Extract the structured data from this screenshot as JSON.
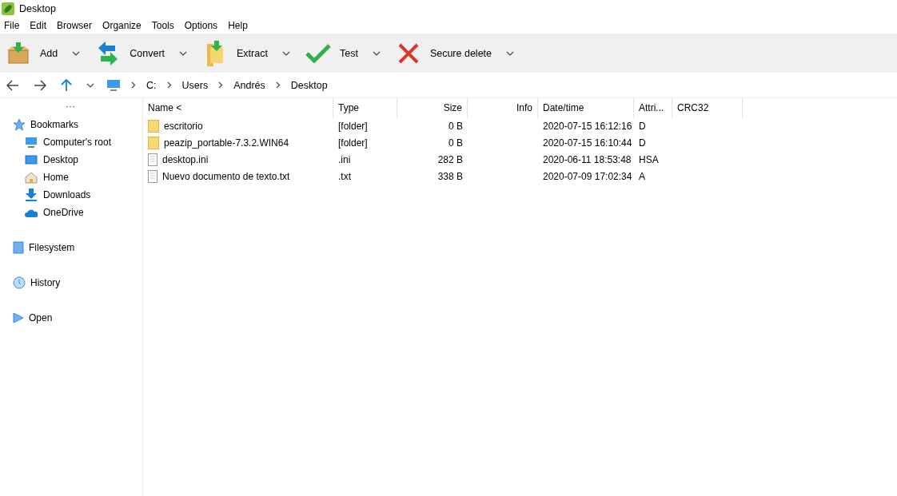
{
  "window": {
    "title": "Desktop"
  },
  "menu": [
    "File",
    "Edit",
    "Browser",
    "Organize",
    "Tools",
    "Options",
    "Help"
  ],
  "toolbar": [
    {
      "kind": "add",
      "label": "Add"
    },
    {
      "kind": "convert",
      "label": "Convert"
    },
    {
      "kind": "extract",
      "label": "Extract"
    },
    {
      "kind": "test",
      "label": "Test"
    },
    {
      "kind": "delete",
      "label": "Secure delete"
    }
  ],
  "breadcrumb": [
    "C:",
    "Users",
    "Andrés",
    "Desktop"
  ],
  "sidebar": {
    "more": "···",
    "sections": [
      {
        "kind": "bookmarks",
        "label": "Bookmarks",
        "children": [
          {
            "kind": "computer",
            "label": "Computer's root"
          },
          {
            "kind": "desktop",
            "label": "Desktop"
          },
          {
            "kind": "home",
            "label": "Home"
          },
          {
            "kind": "downloads",
            "label": "Downloads"
          },
          {
            "kind": "cloud",
            "label": "OneDrive"
          }
        ]
      },
      {
        "kind": "filesystem",
        "label": "Filesystem"
      },
      {
        "kind": "history",
        "label": "History"
      },
      {
        "kind": "open",
        "label": "Open"
      }
    ]
  },
  "table": {
    "columns": [
      "Name <",
      "Type",
      "Size",
      "Info",
      "Date/time",
      "Attri...",
      "CRC32"
    ],
    "rows": [
      {
        "kind": "folder",
        "name": "escritorio",
        "type": "[folder]",
        "size": "0 B",
        "date": "2020-07-15 16:12:16",
        "attr": "D"
      },
      {
        "kind": "folder",
        "name": "peazip_portable-7.3.2.WIN64",
        "type": "[folder]",
        "size": "0 B",
        "date": "2020-07-15 16:10:44",
        "attr": "D"
      },
      {
        "kind": "file",
        "name": "desktop.ini",
        "type": ".ini",
        "size": "282 B",
        "date": "2020-06-11 18:53:48",
        "attr": "HSA"
      },
      {
        "kind": "file",
        "name": "Nuevo documento de texto.txt",
        "type": ".txt",
        "size": "338 B",
        "date": "2020-07-09 17:02:34",
        "attr": "A"
      }
    ]
  }
}
